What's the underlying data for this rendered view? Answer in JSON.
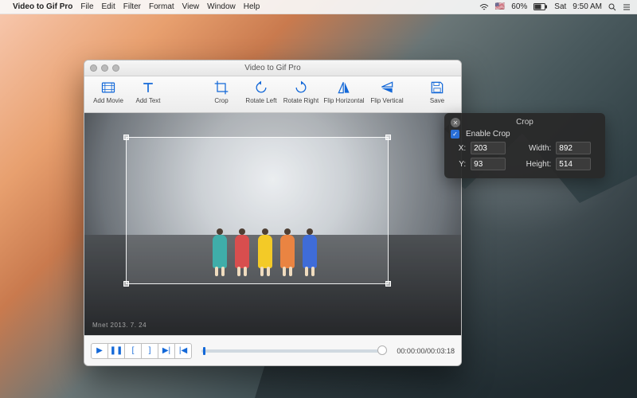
{
  "menubar": {
    "app_name": "Video to Gif Pro",
    "items": [
      "File",
      "Edit",
      "Filter",
      "Format",
      "View",
      "Window",
      "Help"
    ],
    "status": {
      "battery_pct": "60%",
      "flag": "🇺🇸",
      "day": "Sat",
      "time": "9:50 AM"
    }
  },
  "window": {
    "title": "Video to Gif Pro",
    "toolbar": {
      "add_movie": "Add Movie",
      "add_text": "Add Text",
      "crop": "Crop",
      "rotate_left": "Rotate Left",
      "rotate_right": "Rotate Right",
      "flip_horizontal": "Flip Horizontal",
      "flip_vertical": "Flip Vertical",
      "save": "Save"
    },
    "video": {
      "watermark": "Mnet 2013. 7. 24"
    },
    "controls": {
      "timecode": "00:00:00/00:03:18"
    }
  },
  "crop_panel": {
    "title": "Crop",
    "enable_label": "Enable Crop",
    "enabled": true,
    "x_label": "X:",
    "y_label": "Y:",
    "width_label": "Width:",
    "height_label": "Height:",
    "x": "203",
    "y": "93",
    "width": "892",
    "height": "514"
  }
}
